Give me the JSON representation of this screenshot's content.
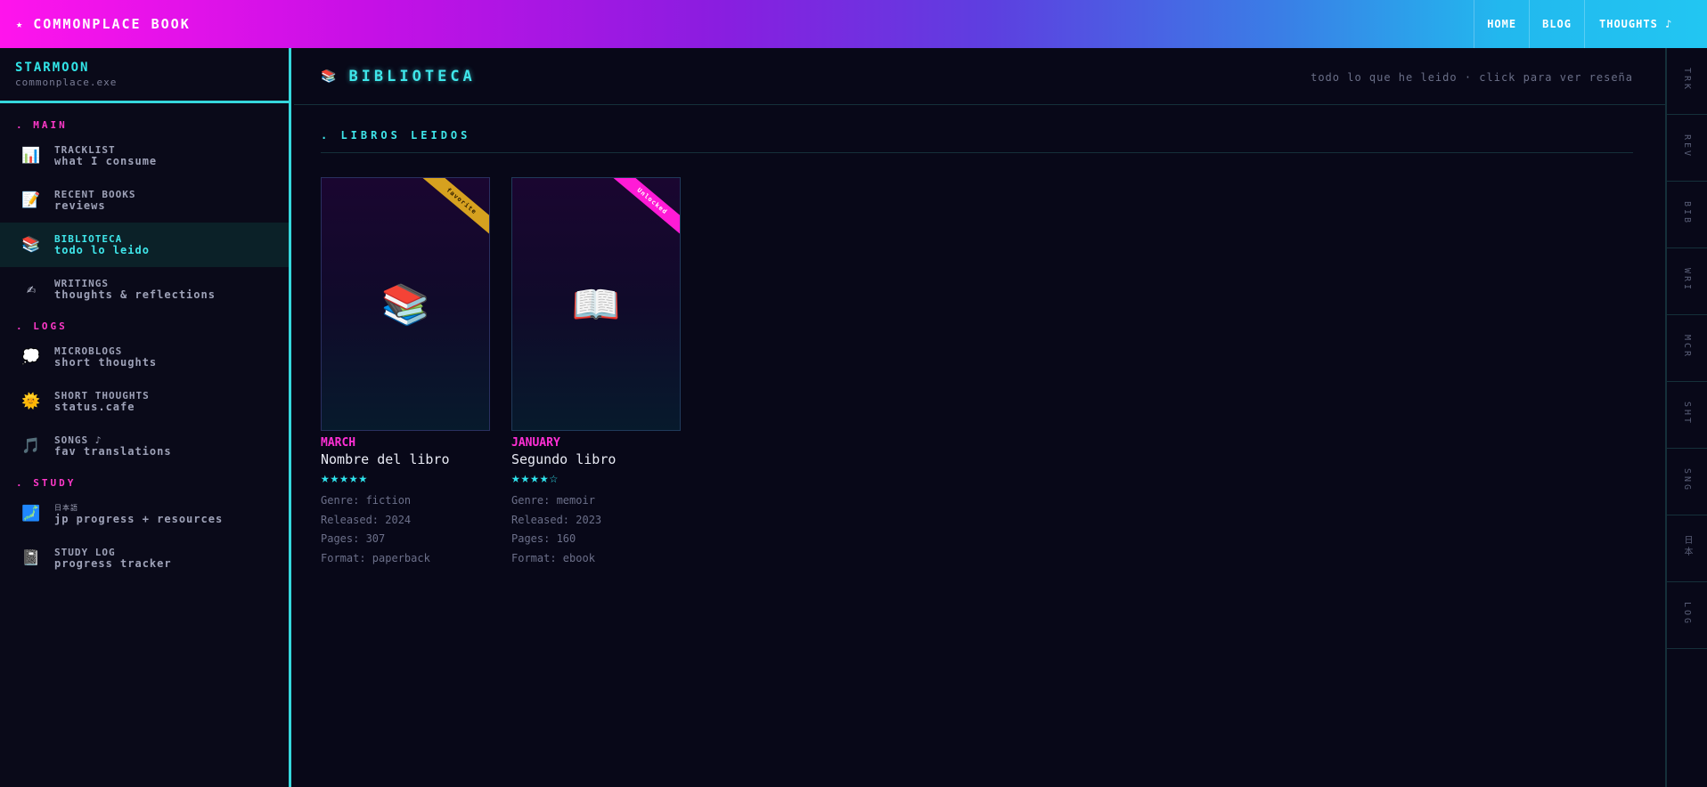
{
  "topbar": {
    "brand": "COMMONPLACE BOOK",
    "star": "★",
    "nav": [
      {
        "label": "HOME"
      },
      {
        "label": "BLOG"
      },
      {
        "label": "THOUGHTS ♪"
      }
    ]
  },
  "sidebar": {
    "title": "STARMOON",
    "subtitle": "commonplace.exe",
    "sections": [
      {
        "label": ". MAIN",
        "items": [
          {
            "icon": "📊",
            "label": "TRACKLIST",
            "desc": "what I consume"
          },
          {
            "icon": "📝",
            "label": "RECENT BOOKS",
            "desc": "reviews"
          },
          {
            "icon": "📚",
            "label": "BIBLIOTECA",
            "desc": "todo lo leido",
            "active": true
          },
          {
            "icon": "✍",
            "label": "WRITINGS",
            "desc": "thoughts & reflections"
          }
        ]
      },
      {
        "label": ". LOGS",
        "items": [
          {
            "icon": "💭",
            "label": "MICROBLOGS",
            "desc": "short thoughts"
          },
          {
            "icon": "🌞",
            "label": "SHORT THOUGHTS",
            "desc": "status.cafe"
          },
          {
            "icon": "🎵",
            "label": "SONGS ♪",
            "desc": "fav translations"
          }
        ]
      },
      {
        "label": ". STUDY",
        "items": [
          {
            "icon": "🗾",
            "label": "日本語",
            "desc": "jp progress + resources"
          },
          {
            "icon": "📓",
            "label": "STUDY LOG",
            "desc": "progress tracker"
          }
        ]
      }
    ]
  },
  "main": {
    "title_icon": "📚",
    "title": "BIBLIOTECA",
    "hint": "todo lo que he leido · click para ver reseña",
    "section_title": ". LIBROS LEIDOS",
    "books": [
      {
        "ribbon": "favorite",
        "cover_icon": "📚",
        "month": "MARCH",
        "title": "Nombre del libro",
        "rating": 5,
        "stars": "★★★★★",
        "genre": "Genre: fiction",
        "released": "Released: 2024",
        "pages": "Pages: 307",
        "format": "Format: paperback"
      },
      {
        "ribbon": "Unlocked",
        "cover_icon": "📖",
        "month": "JANUARY",
        "title": "Segundo libro",
        "rating": 4,
        "stars": "★★★★☆",
        "genre": "Genre: memoir",
        "released": "Released: 2023",
        "pages": "Pages: 160",
        "format": "Format: ebook"
      }
    ]
  },
  "rail": [
    "TRK",
    "REV",
    "BIB",
    "WRI",
    "MCR",
    "SHT",
    "SNG",
    "日本",
    "LOG"
  ],
  "colors": {
    "accent_cyan": "#3fe6ea",
    "accent_pink": "#ff2fd5",
    "background": "#080818"
  }
}
